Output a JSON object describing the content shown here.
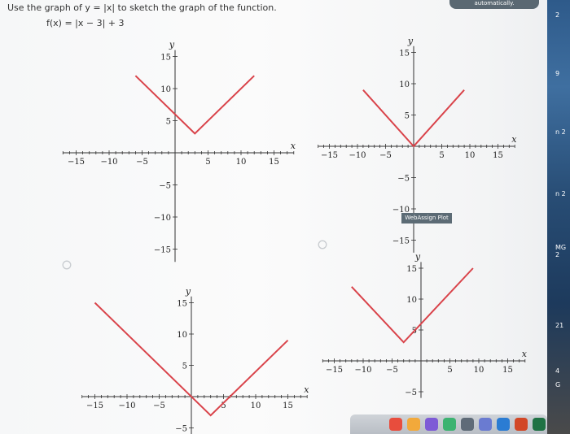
{
  "question": {
    "instruction": "Use the graph of y = |x| to sketch the graph of the function.",
    "function": "f(x) = |x − 3| + 3"
  },
  "banner": "automatically.",
  "webassign_badge": "WebAssign Plot",
  "right_strip_labels": [
    "2",
    "9",
    "n 2",
    "n 2",
    "MG 2",
    "21",
    "4",
    "G"
  ],
  "colors": {
    "line": "#d9434a",
    "axis": "#333333",
    "accent": "#5c6b75"
  },
  "chart_data": [
    {
      "type": "line",
      "x_ticks": [
        -15,
        -10,
        -5,
        5,
        10,
        15
      ],
      "y_ticks": [
        5,
        10,
        15,
        -5,
        -10,
        -15
      ],
      "xlabel": "x",
      "ylabel": "y",
      "xlim": [
        -17,
        18
      ],
      "ylim": [
        -17,
        16
      ],
      "series": [
        {
          "x": [
            -6,
            3,
            12
          ],
          "y": [
            12,
            3,
            12
          ]
        }
      ],
      "selected": false
    },
    {
      "type": "line",
      "x_ticks": [
        -15,
        -10,
        -5,
        5,
        10,
        15
      ],
      "y_ticks": [
        5,
        10,
        15,
        -5,
        -10,
        -15
      ],
      "xlabel": "x",
      "ylabel": "y",
      "xlim": [
        -17,
        18
      ],
      "ylim": [
        -17,
        16
      ],
      "series": [
        {
          "x": [
            -9,
            0,
            9
          ],
          "y": [
            9,
            0,
            9
          ]
        }
      ],
      "selected": false
    },
    {
      "type": "line",
      "x_ticks": [
        -15,
        -10,
        -5,
        5,
        10,
        15
      ],
      "y_ticks": [
        5,
        10,
        15,
        -5
      ],
      "xlabel": "x",
      "ylabel": "y",
      "xlim": [
        -17,
        18
      ],
      "ylim": [
        -6,
        16
      ],
      "series": [
        {
          "x": [
            -15,
            3,
            15
          ],
          "y": [
            15,
            -3,
            9
          ]
        }
      ],
      "selected": false
    },
    {
      "type": "line",
      "x_ticks": [
        -15,
        -10,
        -5,
        5,
        10,
        15
      ],
      "y_ticks": [
        5,
        10,
        15,
        -5
      ],
      "xlabel": "x",
      "ylabel": "y",
      "xlim": [
        -17,
        18
      ],
      "ylim": [
        -6,
        16
      ],
      "series": [
        {
          "x": [
            -12,
            -3,
            9
          ],
          "y": [
            12,
            3,
            15
          ]
        }
      ],
      "selected": false
    }
  ]
}
